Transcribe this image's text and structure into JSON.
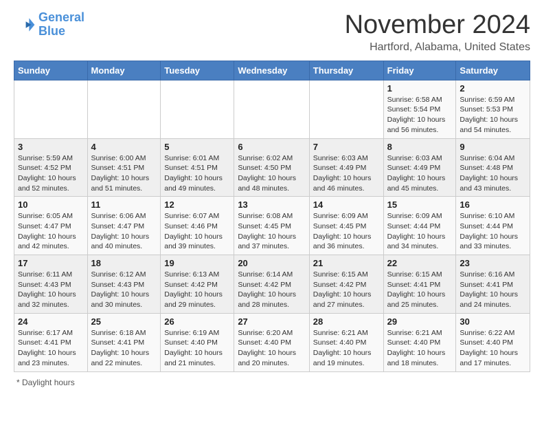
{
  "logo": {
    "line1": "General",
    "line2": "Blue"
  },
  "header": {
    "title": "November 2024",
    "subtitle": "Hartford, Alabama, United States"
  },
  "footer": {
    "daylight_label": "Daylight hours"
  },
  "days_of_week": [
    "Sunday",
    "Monday",
    "Tuesday",
    "Wednesday",
    "Thursday",
    "Friday",
    "Saturday"
  ],
  "weeks": [
    [
      {
        "day": "",
        "info": ""
      },
      {
        "day": "",
        "info": ""
      },
      {
        "day": "",
        "info": ""
      },
      {
        "day": "",
        "info": ""
      },
      {
        "day": "",
        "info": ""
      },
      {
        "day": "1",
        "info": "Sunrise: 6:58 AM\nSunset: 5:54 PM\nDaylight: 10 hours and 56 minutes."
      },
      {
        "day": "2",
        "info": "Sunrise: 6:59 AM\nSunset: 5:53 PM\nDaylight: 10 hours and 54 minutes."
      }
    ],
    [
      {
        "day": "3",
        "info": "Sunrise: 5:59 AM\nSunset: 4:52 PM\nDaylight: 10 hours and 52 minutes."
      },
      {
        "day": "4",
        "info": "Sunrise: 6:00 AM\nSunset: 4:51 PM\nDaylight: 10 hours and 51 minutes."
      },
      {
        "day": "5",
        "info": "Sunrise: 6:01 AM\nSunset: 4:51 PM\nDaylight: 10 hours and 49 minutes."
      },
      {
        "day": "6",
        "info": "Sunrise: 6:02 AM\nSunset: 4:50 PM\nDaylight: 10 hours and 48 minutes."
      },
      {
        "day": "7",
        "info": "Sunrise: 6:03 AM\nSunset: 4:49 PM\nDaylight: 10 hours and 46 minutes."
      },
      {
        "day": "8",
        "info": "Sunrise: 6:03 AM\nSunset: 4:49 PM\nDaylight: 10 hours and 45 minutes."
      },
      {
        "day": "9",
        "info": "Sunrise: 6:04 AM\nSunset: 4:48 PM\nDaylight: 10 hours and 43 minutes."
      }
    ],
    [
      {
        "day": "10",
        "info": "Sunrise: 6:05 AM\nSunset: 4:47 PM\nDaylight: 10 hours and 42 minutes."
      },
      {
        "day": "11",
        "info": "Sunrise: 6:06 AM\nSunset: 4:47 PM\nDaylight: 10 hours and 40 minutes."
      },
      {
        "day": "12",
        "info": "Sunrise: 6:07 AM\nSunset: 4:46 PM\nDaylight: 10 hours and 39 minutes."
      },
      {
        "day": "13",
        "info": "Sunrise: 6:08 AM\nSunset: 4:45 PM\nDaylight: 10 hours and 37 minutes."
      },
      {
        "day": "14",
        "info": "Sunrise: 6:09 AM\nSunset: 4:45 PM\nDaylight: 10 hours and 36 minutes."
      },
      {
        "day": "15",
        "info": "Sunrise: 6:09 AM\nSunset: 4:44 PM\nDaylight: 10 hours and 34 minutes."
      },
      {
        "day": "16",
        "info": "Sunrise: 6:10 AM\nSunset: 4:44 PM\nDaylight: 10 hours and 33 minutes."
      }
    ],
    [
      {
        "day": "17",
        "info": "Sunrise: 6:11 AM\nSunset: 4:43 PM\nDaylight: 10 hours and 32 minutes."
      },
      {
        "day": "18",
        "info": "Sunrise: 6:12 AM\nSunset: 4:43 PM\nDaylight: 10 hours and 30 minutes."
      },
      {
        "day": "19",
        "info": "Sunrise: 6:13 AM\nSunset: 4:42 PM\nDaylight: 10 hours and 29 minutes."
      },
      {
        "day": "20",
        "info": "Sunrise: 6:14 AM\nSunset: 4:42 PM\nDaylight: 10 hours and 28 minutes."
      },
      {
        "day": "21",
        "info": "Sunrise: 6:15 AM\nSunset: 4:42 PM\nDaylight: 10 hours and 27 minutes."
      },
      {
        "day": "22",
        "info": "Sunrise: 6:15 AM\nSunset: 4:41 PM\nDaylight: 10 hours and 25 minutes."
      },
      {
        "day": "23",
        "info": "Sunrise: 6:16 AM\nSunset: 4:41 PM\nDaylight: 10 hours and 24 minutes."
      }
    ],
    [
      {
        "day": "24",
        "info": "Sunrise: 6:17 AM\nSunset: 4:41 PM\nDaylight: 10 hours and 23 minutes."
      },
      {
        "day": "25",
        "info": "Sunrise: 6:18 AM\nSunset: 4:41 PM\nDaylight: 10 hours and 22 minutes."
      },
      {
        "day": "26",
        "info": "Sunrise: 6:19 AM\nSunset: 4:40 PM\nDaylight: 10 hours and 21 minutes."
      },
      {
        "day": "27",
        "info": "Sunrise: 6:20 AM\nSunset: 4:40 PM\nDaylight: 10 hours and 20 minutes."
      },
      {
        "day": "28",
        "info": "Sunrise: 6:21 AM\nSunset: 4:40 PM\nDaylight: 10 hours and 19 minutes."
      },
      {
        "day": "29",
        "info": "Sunrise: 6:21 AM\nSunset: 4:40 PM\nDaylight: 10 hours and 18 minutes."
      },
      {
        "day": "30",
        "info": "Sunrise: 6:22 AM\nSunset: 4:40 PM\nDaylight: 10 hours and 17 minutes."
      }
    ]
  ]
}
